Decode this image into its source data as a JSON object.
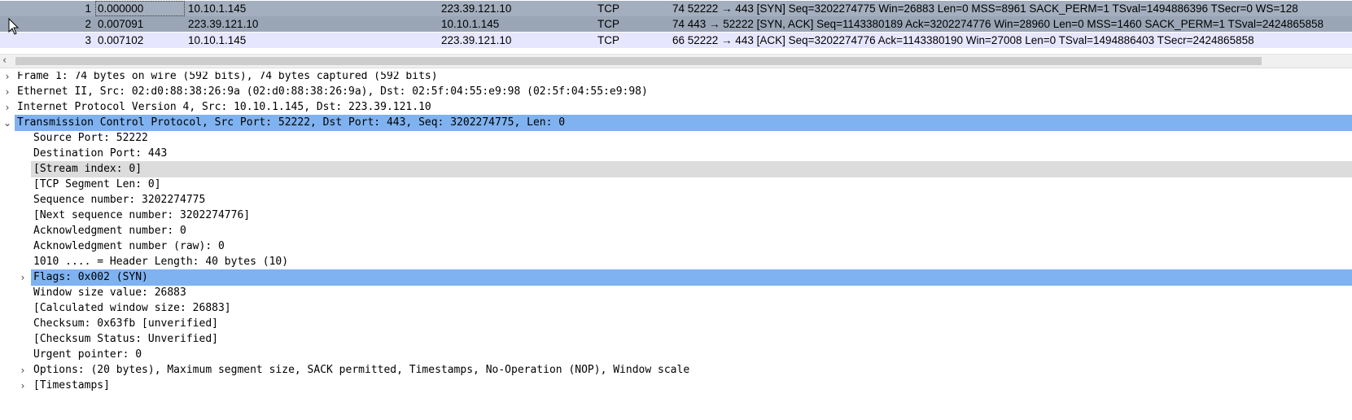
{
  "packets": [
    {
      "no": "1",
      "time": "0.000000",
      "src": "10.10.1.145",
      "dst": "223.39.121.10",
      "proto": "TCP",
      "info": "74 52222 → 443 [SYN] Seq=3202274775 Win=26883 Len=0 MSS=8961 SACK_PERM=1 TSval=1494886396 TSecr=0 WS=128"
    },
    {
      "no": "2",
      "time": "0.007091",
      "src": "223.39.121.10",
      "dst": "10.10.1.145",
      "proto": "TCP",
      "info": "74 443 → 52222 [SYN, ACK] Seq=1143380189 Ack=3202274776 Win=28960 Len=0 MSS=1460 SACK_PERM=1 TSval=2424865858"
    },
    {
      "no": "3",
      "time": "0.007102",
      "src": "10.10.1.145",
      "dst": "223.39.121.10",
      "proto": "TCP",
      "info": "66 52222 → 443 [ACK] Seq=3202274776 Ack=1143380190 Win=27008 Len=0 TSval=1494886403 TSecr=2424865858"
    }
  ],
  "scroll_left_glyph": "‹",
  "icons": {
    "collapsed": "›",
    "expanded": "⌄",
    "cursor": "mouse-pointer-icon"
  },
  "details": {
    "frame": "Frame 1: 74 bytes on wire (592 bits), 74 bytes captured (592 bits)",
    "ethernet": "Ethernet II, Src: 02:d0:88:38:26:9a (02:d0:88:38:26:9a), Dst: 02:5f:04:55:e9:98 (02:5f:04:55:e9:98)",
    "ipv4": "Internet Protocol Version 4, Src: 10.10.1.145, Dst: 223.39.121.10",
    "tcp": "Transmission Control Protocol, Src Port: 52222, Dst Port: 443, Seq: 3202274775, Len: 0",
    "tcp_fields": {
      "src_port": "Source Port: 52222",
      "dst_port": "Destination Port: 443",
      "stream_index": "[Stream index: 0]",
      "segment_len": "[TCP Segment Len: 0]",
      "seq": "Sequence number: 3202274775",
      "next_seq": "[Next sequence number: 3202274776]",
      "ack": "Acknowledgment number: 0",
      "ack_raw": "Acknowledgment number (raw): 0",
      "header_len": "1010 .... = Header Length: 40 bytes (10)",
      "flags": "Flags: 0x002 (SYN)",
      "window": "Window size value: 26883",
      "calc_window": "[Calculated window size: 26883]",
      "checksum": "Checksum: 0x63fb [unverified]",
      "checksum_status": "[Checksum Status: Unverified]",
      "urgent": "Urgent pointer: 0",
      "options": "Options: (20 bytes), Maximum segment size, SACK permitted, Timestamps, No-Operation (NOP), Window scale",
      "timestamps": "[Timestamps]"
    }
  },
  "colors": {
    "selected_row": "#a3aebe",
    "tcp_row": "#e7e6ff",
    "tree_highlight": "#7fb2f0",
    "tree_focus": "#dcdcdc"
  }
}
